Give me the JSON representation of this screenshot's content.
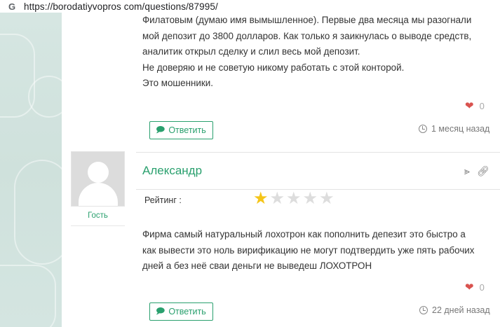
{
  "browser": {
    "favicon_letter": "G",
    "url": "https://borodatiyvopros com/questions/87995/"
  },
  "comment1": {
    "lines": [
      "Филатовым (думаю имя вымышленное). Первые два месяца мы разогнали",
      "мой депозит до 3800 долларов. Как только я заикнулась о выводе средств,",
      "аналитик открыл сделку и слил весь мой депозит.",
      "Не доверяю и не советую никому работать с этой конторой.",
      "Это мошенники."
    ],
    "likes": "0",
    "reply_label": "Ответить",
    "time": "1 месяц назад"
  },
  "comment2": {
    "author": "Александр",
    "role": "Гость",
    "rating_label": "Рейтинг :",
    "rating": 1,
    "rating_max": 5,
    "lines": [
      "Фирма самый натуральный лохотрон как пополнить депезит это быстро а",
      "как вывести это ноль вирификацию не могут подтвердить уже пять рабочих",
      "дней а без неё сваи деньги не выведеш ЛОХОТРОН"
    ],
    "likes": "0",
    "reply_label": "Ответить",
    "time": "22 дней назад"
  },
  "colors": {
    "accent": "#2aa06e",
    "heart": "#d9534f",
    "star_on": "#f5c518",
    "star_off": "#dddddd"
  }
}
